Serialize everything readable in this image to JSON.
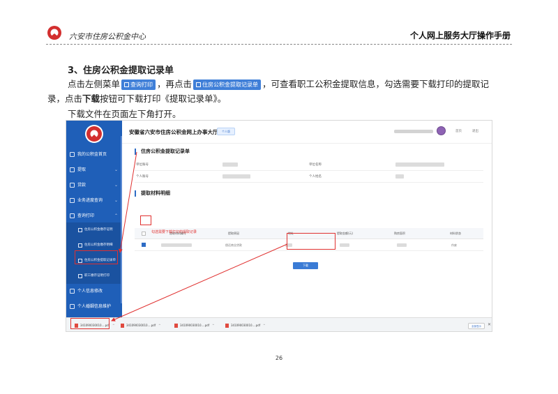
{
  "header": {
    "center_name": "六安市住房公积金中心",
    "manual_title": "个人网上服务大厅操作手册",
    "brand_color": "#d32f2f"
  },
  "body": {
    "section_title": "3、住房公积金提取记录单",
    "p1_a": "点击左侧菜单",
    "p1_btn1": "查询打印",
    "p1_b": "，再点击",
    "p1_btn2": "住房公积金提取记录单",
    "p1_c": "，可查看职工公积金提取信息，勾选需要下载打印的提取记",
    "p2_a": "录，点击",
    "p2_bold": "下载",
    "p2_b": "按钮可下载打印《提取记录单》。",
    "p3": "下载文件在页面左下角打开。"
  },
  "screenshot": {
    "site_title": "安徽省六安市住房公积金网上办事大厅",
    "version_chip": "个人版",
    "topbar_links": [
      "首页",
      "退出"
    ],
    "sidebar": {
      "items": [
        {
          "label": "我的公积金首页"
        },
        {
          "label": "提取"
        },
        {
          "label": "贷款"
        },
        {
          "label": "业务进度查询"
        },
        {
          "label": "查询打印"
        }
      ],
      "subitems": [
        {
          "label": "住房公积金缴存证明"
        },
        {
          "label": "住房公积金缴存明细"
        },
        {
          "label": "住房公积金提取记录单"
        },
        {
          "label": "职工缴存证明打印"
        }
      ],
      "bottom_items": [
        {
          "label": "个人信息修改"
        },
        {
          "label": "个人婚姻信息维护"
        }
      ]
    },
    "record_section_title": "住房公积金提取记录单",
    "form_labels": [
      "单位账号",
      "单位名称",
      "个人账号",
      "个人姓名"
    ],
    "detail_section_title": "提取材料明细",
    "table": {
      "headers": [
        "提取材料编号",
        "提取原因",
        "地址",
        "提取金额(元)",
        "购房面积",
        "材料状态"
      ],
      "row": [
        "偿还商业贷款",
        "作废"
      ]
    },
    "annotation": "勾选需要下载打印的提取记录",
    "download_label": "下载",
    "download_bar": {
      "files": [
        "341090030010....pdf",
        "341090030010....pdf",
        "341090030010....pdf",
        "341090030010....pdf"
      ],
      "show_all": "全部显示"
    },
    "accent_color": "#1f5fb8",
    "highlight_color": "#e0302f"
  },
  "page_number": "26"
}
